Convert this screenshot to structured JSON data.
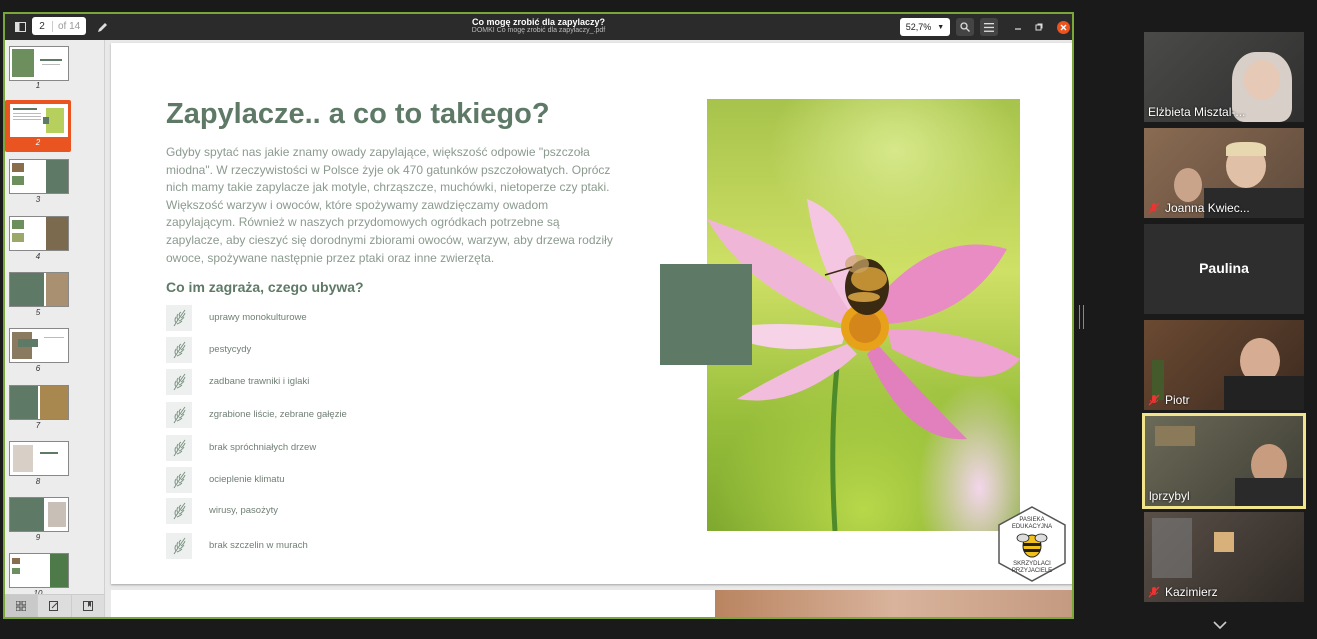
{
  "viewer": {
    "title": "Co mogę zrobić dla zapylaczy?",
    "subtitle": "DOMKI Co mogę zrobić dla zapylaczy_.pdf",
    "page_current": "2",
    "page_total": "of 14",
    "zoom": "52,7%",
    "toolbar": {
      "sidebar_icon": "sidebar-toggle-icon",
      "annotate_icon": "pen-icon",
      "search_icon": "search-icon",
      "menu_icon": "hamburger-menu-icon",
      "minimize_icon": "minimize-icon",
      "restore_icon": "restore-icon",
      "close_icon": "close-icon",
      "zoom_dropdown_icon": "chevron-down-icon"
    },
    "thumbnails": [
      "1",
      "2",
      "3",
      "4",
      "5",
      "6",
      "7",
      "8",
      "9",
      "10"
    ],
    "selected_thumbnail": "2",
    "sidebar_tabs": [
      "thumbnails-icon",
      "annotations-icon",
      "bookmarks-icon"
    ],
    "accent_color": "#e95420"
  },
  "slide": {
    "heading": "Zapylacze.. a co to takiego?",
    "paragraph": "Gdyby spytać nas jakie znamy owady zapylające, większość odpowie \"pszczoła miodna\". W rzeczywistości w Polsce żyje ok 470 gatunków pszczołowatych. Oprócz nich mamy takie zapylacze jak motyle, chrząszcze, muchówki, nietoperze czy ptaki. Większość warzyw i owoców, które spożywamy zawdzięczamy owadom zapylającym. Również w naszych przydomowych ogródkach potrzebne są zapylacze, aby cieszyć się dorodnymi zbiorami owoców, warzyw, aby drzewa rodziły owoce, spożywane następnie przez ptaki oraz inne zwierzęta.",
    "subheading": "Co im zagraża, czego ubywa?",
    "threats": [
      "uprawy monokulturowe",
      "pestycydy",
      "zadbane trawniki i iglaki",
      "zgrabione liście, zebrane gałęzie",
      "brak spróchniałych drzew",
      "ocieplenie klimatu",
      "wirusy, pasożyty",
      "brak szczelin w murach"
    ],
    "badge": {
      "line1": "PASIEKA",
      "line2": "EDUKACYJNA",
      "line3": "SKRZYDLACI",
      "line4": "PRZYJACIELE"
    },
    "theme_color": "#5e7a67"
  },
  "participants": [
    {
      "name": "Elżbieta Misztal-...",
      "muted": false
    },
    {
      "name": "Joanna Kwiec...",
      "muted": true
    },
    {
      "name": "Paulina",
      "muted": false,
      "video_off": true
    },
    {
      "name": "Piotr",
      "muted": true
    },
    {
      "name": "lprzybyl",
      "muted": false,
      "speaking": true
    },
    {
      "name": "Kazimierz",
      "muted": true
    }
  ],
  "gallery": {
    "more_icon": "chevron-down-icon",
    "speaking_color": "#f1e48a"
  }
}
